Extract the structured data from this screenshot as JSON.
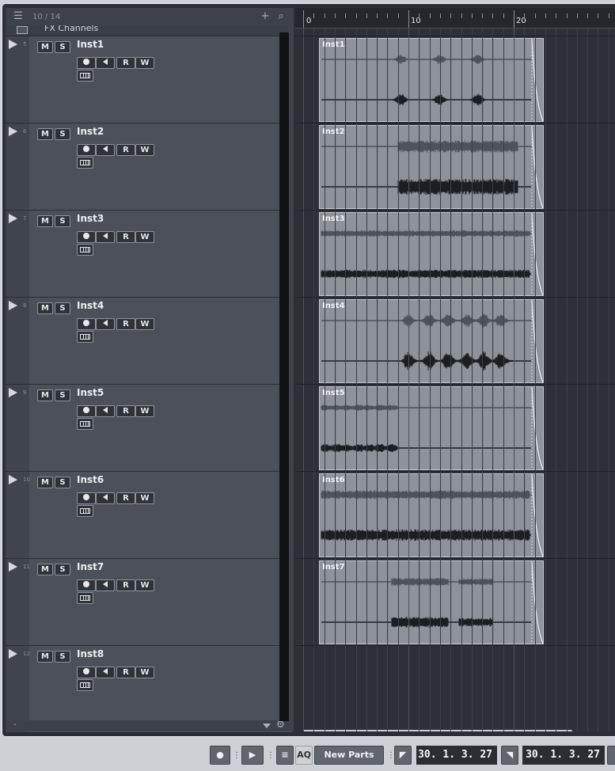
{
  "track_list": {
    "count_label": "10 / 14",
    "fx_label": "FX Channels",
    "icons": {
      "menu": "list-icon",
      "add": "plus-icon",
      "search": "search-icon",
      "settings": "gear-icon"
    },
    "footer_minus": "-",
    "tracks": [
      {
        "num": "5",
        "name": "Inst1",
        "mute": "M",
        "solo": "S",
        "read": "R",
        "write": "W"
      },
      {
        "num": "6",
        "name": "Inst2",
        "mute": "M",
        "solo": "S",
        "read": "R",
        "write": "W"
      },
      {
        "num": "7",
        "name": "Inst3",
        "mute": "M",
        "solo": "S",
        "read": "R",
        "write": "W"
      },
      {
        "num": "8",
        "name": "Inst4",
        "mute": "M",
        "solo": "S",
        "read": "R",
        "write": "W"
      },
      {
        "num": "9",
        "name": "Inst5",
        "mute": "M",
        "solo": "S",
        "read": "R",
        "write": "W"
      },
      {
        "num": "10",
        "name": "Inst6",
        "mute": "M",
        "solo": "S",
        "read": "R",
        "write": "W"
      },
      {
        "num": "11",
        "name": "Inst7",
        "mute": "M",
        "solo": "S",
        "read": "R",
        "write": "W"
      },
      {
        "num": "12",
        "name": "Inst8",
        "mute": "M",
        "solo": "S",
        "read": "R",
        "write": "W"
      }
    ]
  },
  "ruler": {
    "labels": [
      "0",
      "10",
      "20"
    ]
  },
  "events": [
    {
      "name": "Inst1",
      "wave": "bursts"
    },
    {
      "name": "Inst2",
      "wave": "late-dense"
    },
    {
      "name": "Inst3",
      "wave": "full"
    },
    {
      "name": "Inst4",
      "wave": "spiky"
    },
    {
      "name": "Inst5",
      "wave": "early"
    },
    {
      "name": "Inst6",
      "wave": "full-dense"
    },
    {
      "name": "Inst7",
      "wave": "mid"
    }
  ],
  "transport": {
    "aq_label": "AQ",
    "new_parts_label": "New Parts",
    "left_locator": "30. 1. 3. 27",
    "right_locator": "30. 1. 3. 27"
  },
  "colors": {
    "event_bg": "#8e9399",
    "track_bg": "#4b5059",
    "wave_dark": "#1c1f22"
  }
}
